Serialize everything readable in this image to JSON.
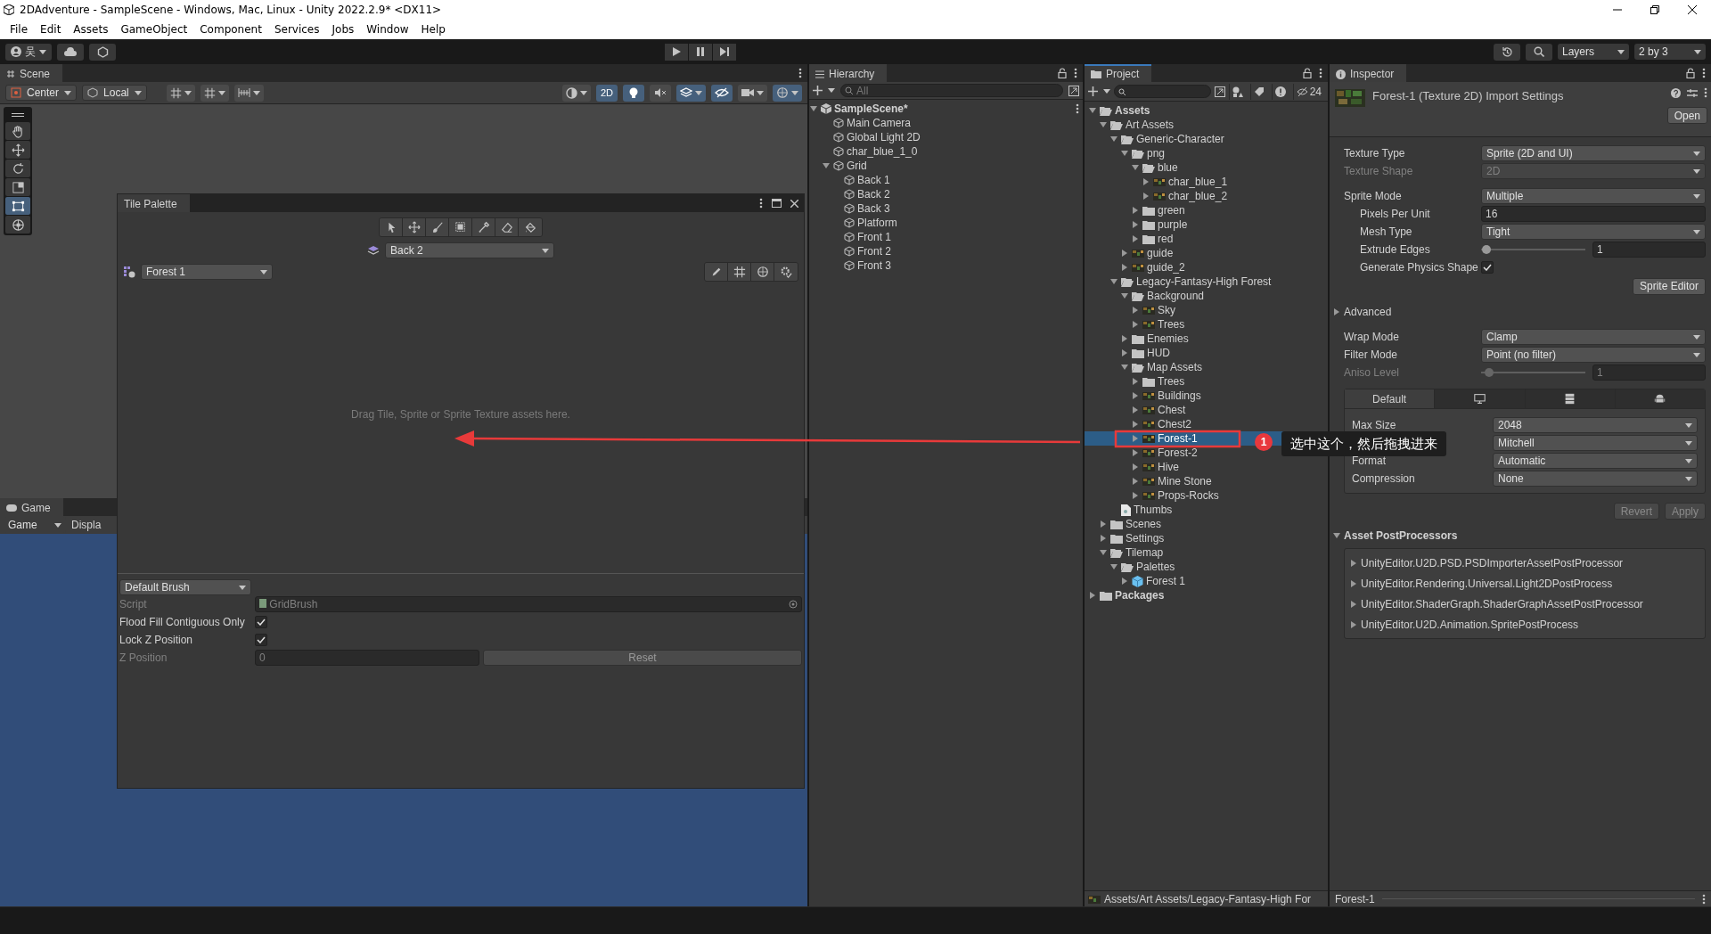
{
  "window": {
    "title": "2DAdventure - SampleScene - Windows, Mac, Linux - Unity 2022.2.9* <DX11>"
  },
  "menu": [
    "File",
    "Edit",
    "Assets",
    "GameObject",
    "Component",
    "Services",
    "Jobs",
    "Window",
    "Help"
  ],
  "toolbar": {
    "account": "吴",
    "layers": "Layers",
    "layout": "2 by 3"
  },
  "scene": {
    "tab": "Scene",
    "focused": false,
    "pivot": "Center",
    "space": "Local",
    "view_buttons": [
      {
        "kind": "shading",
        "on": false
      },
      {
        "kind": "dimension",
        "label": "2D",
        "on": true
      },
      {
        "kind": "light",
        "on": true
      },
      {
        "kind": "audio",
        "on": false
      },
      {
        "kind": "effects",
        "on": true
      },
      {
        "kind": "visibility",
        "on": true
      },
      {
        "kind": "camera",
        "on": false
      },
      {
        "kind": "gizmos",
        "on": true
      }
    ],
    "tools": [
      {
        "kind": "hand",
        "selected": false
      },
      {
        "kind": "move",
        "selected": false
      },
      {
        "kind": "rotate",
        "selected": false
      },
      {
        "kind": "scale",
        "selected": false
      },
      {
        "kind": "rect",
        "selected": true
      },
      {
        "kind": "transform",
        "selected": false
      }
    ]
  },
  "tile_palette": {
    "title": "Tile Palette",
    "tools": [
      {
        "kind": "select"
      },
      {
        "kind": "move"
      },
      {
        "kind": "paint"
      },
      {
        "kind": "box"
      },
      {
        "kind": "picker"
      },
      {
        "kind": "erase"
      },
      {
        "kind": "fill"
      }
    ],
    "active_target": "Back 2",
    "palette": "Forest 1",
    "hint": "Drag Tile, Sprite or Sprite Texture assets here.",
    "brush": "Default Brush",
    "fields": [
      {
        "kind": "object",
        "label": "Script",
        "value": "GridBrush",
        "disabled": true
      },
      {
        "kind": "checkbox",
        "label": "Flood Fill Contiguous Only",
        "checked": true,
        "disabled": false
      },
      {
        "kind": "checkbox",
        "label": "Lock Z Position",
        "checked": true,
        "disabled": false
      },
      {
        "kind": "number",
        "label": "Z Position",
        "value": "0",
        "disabled": true,
        "button": "Reset"
      }
    ]
  },
  "game": {
    "tab": "Game",
    "focused": false,
    "display": "Game",
    "display_2": "Displa"
  },
  "hierarchy": {
    "title": "Hierarchy",
    "focused": false,
    "search_placeholder": "All",
    "scene": "SampleScene*",
    "items": [
      {
        "name": "Main Camera"
      },
      {
        "name": "Global Light 2D"
      },
      {
        "name": "char_blue_1_0"
      },
      {
        "name": "Grid",
        "expanded": true,
        "children": [
          {
            "name": "Back 1"
          },
          {
            "name": "Back 2"
          },
          {
            "name": "Back 3"
          },
          {
            "name": "Platform"
          },
          {
            "name": "Front 1"
          },
          {
            "name": "Front 2"
          },
          {
            "name": "Front 3"
          }
        ]
      }
    ]
  },
  "project": {
    "title": "Project",
    "focused": true,
    "hidden_count": "24",
    "path": "Assets/Art Assets/Legacy-Fantasy-High For",
    "tree": [
      {
        "name": "Assets",
        "kind": "folder",
        "expanded": true,
        "selected": false,
        "children": [
          {
            "name": "Art Assets",
            "kind": "folder",
            "expanded": true,
            "selected": false,
            "children": [
              {
                "name": "Generic-Character",
                "kind": "folder",
                "expanded": true,
                "selected": false,
                "children": [
                  {
                    "name": "png",
                    "kind": "folder",
                    "expanded": true,
                    "selected": false,
                    "children": [
                      {
                        "name": "blue",
                        "kind": "folder",
                        "expanded": true,
                        "selected": false,
                        "children": [
                          {
                            "name": "char_blue_1",
                            "kind": "sprite",
                            "expanded": false,
                            "selected": false
                          },
                          {
                            "name": "char_blue_2",
                            "kind": "sprite",
                            "expanded": false,
                            "selected": false
                          }
                        ]
                      },
                      {
                        "name": "green",
                        "kind": "folder",
                        "expanded": false,
                        "selected": false
                      },
                      {
                        "name": "purple",
                        "kind": "folder",
                        "expanded": false,
                        "selected": false
                      },
                      {
                        "name": "red",
                        "kind": "folder",
                        "expanded": false,
                        "selected": false
                      }
                    ]
                  },
                  {
                    "name": "guide",
                    "kind": "sprite",
                    "expanded": false,
                    "selected": false
                  },
                  {
                    "name": "guide_2",
                    "kind": "sprite",
                    "expanded": false,
                    "selected": false
                  }
                ]
              },
              {
                "name": "Legacy-Fantasy-High Forest",
                "kind": "folder",
                "expanded": true,
                "selected": false,
                "children": [
                  {
                    "name": "Background",
                    "kind": "folder",
                    "expanded": true,
                    "selected": false,
                    "children": [
                      {
                        "name": "Sky",
                        "kind": "sprite",
                        "expanded": false,
                        "selected": false
                      },
                      {
                        "name": "Trees",
                        "kind": "sprite",
                        "expanded": false,
                        "selected": false
                      }
                    ]
                  },
                  {
                    "name": "Enemies",
                    "kind": "folder",
                    "expanded": false,
                    "selected": false
                  },
                  {
                    "name": "HUD",
                    "kind": "folder",
                    "expanded": false,
                    "selected": false
                  },
                  {
                    "name": "Map Assets",
                    "kind": "folder",
                    "expanded": true,
                    "selected": false,
                    "children": [
                      {
                        "name": "Trees",
                        "kind": "folder",
                        "expanded": false,
                        "selected": false
                      },
                      {
                        "name": "Buildings",
                        "kind": "sprite",
                        "expanded": false,
                        "selected": false
                      },
                      {
                        "name": "Chest",
                        "kind": "sprite",
                        "expanded": false,
                        "selected": false
                      },
                      {
                        "name": "Chest2",
                        "kind": "sprite",
                        "expanded": false,
                        "selected": false
                      },
                      {
                        "name": "Forest-1",
                        "kind": "sprite",
                        "expanded": false,
                        "selected": true
                      },
                      {
                        "name": "Forest-2",
                        "kind": "sprite",
                        "expanded": false,
                        "selected": false
                      },
                      {
                        "name": "Hive",
                        "kind": "sprite",
                        "expanded": false,
                        "selected": false
                      },
                      {
                        "name": "Mine Stone",
                        "kind": "sprite",
                        "expanded": false,
                        "selected": false
                      },
                      {
                        "name": "Props-Rocks",
                        "kind": "sprite",
                        "expanded": false,
                        "selected": false
                      }
                    ]
                  }
                ]
              },
              {
                "name": "Thumbs",
                "kind": "file",
                "selected": false
              }
            ]
          },
          {
            "name": "Scenes",
            "kind": "folder",
            "expanded": false,
            "selected": false
          },
          {
            "name": "Settings",
            "kind": "folder",
            "expanded": false,
            "selected": false
          },
          {
            "name": "Tilemap",
            "kind": "folder",
            "expanded": true,
            "selected": false,
            "children": [
              {
                "name": "Palettes",
                "kind": "folder",
                "expanded": true,
                "selected": false,
                "children": [
                  {
                    "name": "Forest 1",
                    "kind": "palette",
                    "expanded": false,
                    "selected": false
                  }
                ]
              }
            ]
          }
        ]
      },
      {
        "name": "Packages",
        "kind": "folder",
        "expanded": false,
        "selected": false
      }
    ]
  },
  "inspector": {
    "title": "Inspector",
    "focused": false,
    "asset": "Forest-1 (Texture 2D) Import Settings",
    "open_button": "Open",
    "sections": [
      {
        "rows": [
          {
            "kind": "dropdown",
            "label": "Texture Type",
            "value": "Sprite (2D and UI)",
            "disabled": false
          },
          {
            "kind": "dropdown",
            "label": "Texture Shape",
            "value": "2D",
            "disabled": true
          }
        ]
      },
      {
        "rows": [
          {
            "kind": "dropdown",
            "label": "Sprite Mode",
            "value": "Multiple",
            "disabled": false,
            "children": [
              {
                "kind": "number",
                "label": "Pixels Per Unit",
                "value": "16",
                "disabled": false
              },
              {
                "kind": "dropdown",
                "label": "Mesh Type",
                "value": "Tight",
                "disabled": false
              },
              {
                "kind": "slider",
                "label": "Extrude Edges",
                "value": "1",
                "level": 0.05,
                "disabled": false
              },
              {
                "kind": "checkbox",
                "label": "Generate Physics Shape",
                "checked": true,
                "disabled": false
              }
            ]
          },
          {
            "kind": "button",
            "label": "Sprite Editor"
          }
        ]
      },
      {
        "rows": [
          {
            "kind": "foldout",
            "label": "Advanced",
            "expanded": false
          }
        ]
      },
      {
        "rows": [
          {
            "kind": "dropdown",
            "label": "Wrap Mode",
            "value": "Clamp",
            "disabled": false
          },
          {
            "kind": "dropdown",
            "label": "Filter Mode",
            "value": "Point (no filter)",
            "disabled": false
          },
          {
            "kind": "slider",
            "label": "Aniso Level",
            "value": "1",
            "level": 0.08,
            "disabled": true
          }
        ]
      }
    ],
    "platform_tabs": [
      {
        "kind": "text",
        "label": "Default",
        "selected": true
      },
      {
        "kind": "monitor",
        "selected": false
      },
      {
        "kind": "server",
        "selected": false
      },
      {
        "kind": "android",
        "selected": false
      }
    ],
    "platform_rows": [
      {
        "label": "Max Size",
        "value": "2048"
      },
      {
        "value": "Mitchell"
      },
      {
        "label": "Format",
        "value": "Automatic"
      },
      {
        "label": "Compression",
        "value": "None"
      }
    ],
    "buttons": [
      "Revert",
      "Apply"
    ],
    "postprocessors": {
      "title": "Asset PostProcessors",
      "expanded": true,
      "items": [
        "UnityEditor.U2D.PSD.PSDImporterAssetPostProcessor",
        "UnityEditor.Rendering.Universal.Light2DPostProcess",
        "UnityEditor.ShaderGraph.ShaderGraphAssetPostProcessor",
        "UnityEditor.U2D.Animation.SpritePostProcess"
      ]
    },
    "footer": "Forest-1"
  },
  "annotation": {
    "badge": "1",
    "note": "选中这个，然后拖拽进来"
  }
}
